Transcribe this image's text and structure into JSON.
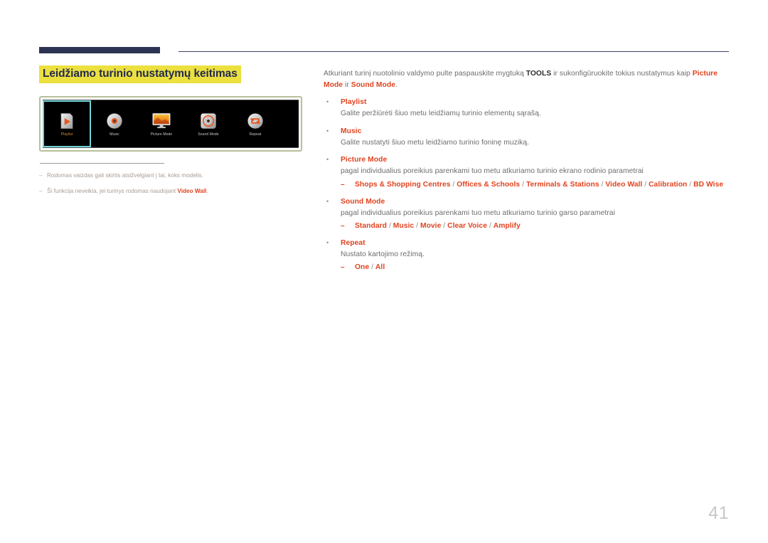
{
  "header": {
    "title": "Leidžiamo turinio nustatymų keitimas"
  },
  "device_menu": {
    "items": [
      {
        "label": "Playlist",
        "icon": "playlist-file-play-icon",
        "selected": true
      },
      {
        "label": "Music",
        "icon": "music-disc-icon",
        "selected": false
      },
      {
        "label": "Picture Mode",
        "icon": "picture-mode-monitor-icon",
        "selected": false
      },
      {
        "label": "Sound Mode",
        "icon": "sound-mode-speaker-icon",
        "selected": false
      },
      {
        "label": "Repeat",
        "icon": "repeat-loop-icon",
        "selected": false
      }
    ]
  },
  "notes": {
    "dash": "–",
    "items": [
      {
        "text": "Rodomas vaizdas gali skirtis atsižvelgiant į tai, koks modelis.",
        "highlight": "",
        "tail": ""
      },
      {
        "text": "Ši funkcija neveikia, jei turinys rodomas naudojant ",
        "highlight": "Video Wall",
        "tail": "."
      }
    ]
  },
  "intro": {
    "part1": "Atkuriant turinį nuotolinio valdymo pulte paspauskite mygtuką ",
    "tools": "TOOLS",
    "part2": " ir sukonfigūruokite tokius nustatymus kaip ",
    "picture_mode": "Picture Mode",
    "part3": " ir ",
    "sound_mode": "Sound Mode",
    "part4": "."
  },
  "bullets": [
    {
      "bullet": "•",
      "title": "Playlist",
      "desc": "Galite peržiūrėti šiuo metu leidžiamų turinio elementų sąrašą.",
      "options": []
    },
    {
      "bullet": "•",
      "title": "Music",
      "desc": "Galite nustatyti šiuo metu leidžiamo turinio foninę muziką.",
      "options": []
    },
    {
      "bullet": "•",
      "title": "Picture Mode",
      "desc": "pagal individualius poreikius parenkami tuo metu atkuriamo turinio ekrano rodinio parametrai",
      "options": [
        "Shops & Shopping Centres",
        "Offices & Schools",
        "Terminals & Stations",
        "Video Wall",
        "Calibration",
        "BD Wise"
      ]
    },
    {
      "bullet": "•",
      "title": "Sound Mode",
      "desc": "pagal individualius poreikius parenkami tuo metu atkuriamo turinio garso parametrai",
      "options": [
        "Standard",
        "Music",
        "Movie",
        "Clear Voice",
        "Amplify"
      ]
    },
    {
      "bullet": "•",
      "title": "Repeat",
      "desc": "Nustato kartojimo režimą.",
      "options": [
        "One",
        "All"
      ]
    }
  ],
  "sub_dash": "–",
  "option_separator": "/",
  "footer": {
    "page_number": "41"
  },
  "colors": {
    "accent_red": "#e0431f",
    "title_navy": "#222a4d",
    "highlight_yellow": "#ece03f",
    "frame_green": "#b6c09a",
    "selected_cyan": "#6fd4d8"
  }
}
